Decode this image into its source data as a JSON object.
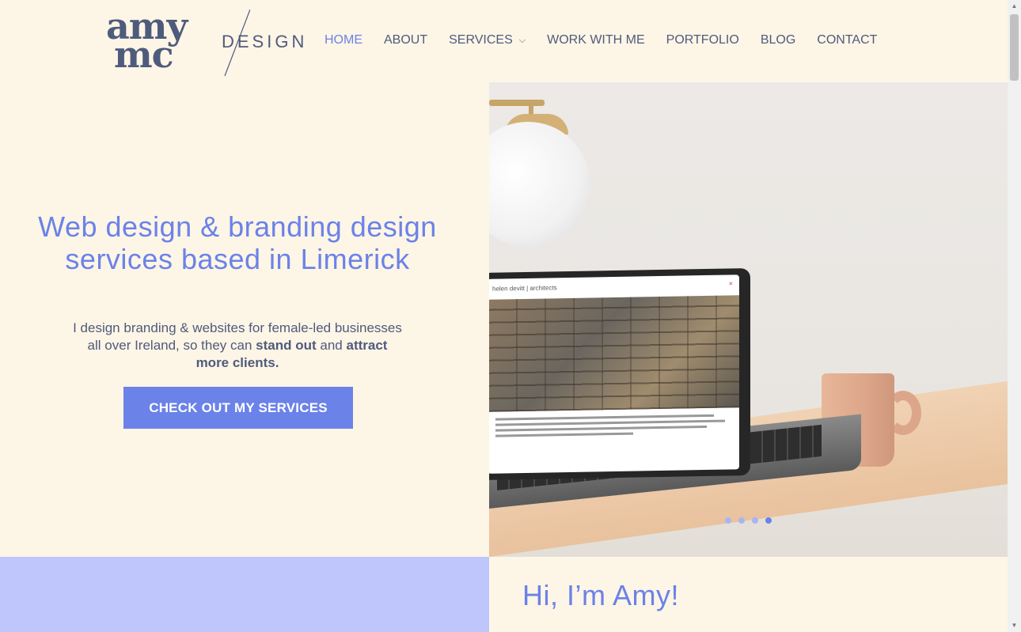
{
  "logo": {
    "line1": "amy",
    "line2": "mc",
    "wordmark": "DESIGN"
  },
  "nav": {
    "items": [
      {
        "label": "HOME",
        "active": true
      },
      {
        "label": "ABOUT"
      },
      {
        "label": "SERVICES",
        "has_dropdown": true,
        "dropdown_icon": "chevron-down-icon"
      },
      {
        "label": "WORK WITH ME"
      },
      {
        "label": "PORTFOLIO"
      },
      {
        "label": "BLOG"
      },
      {
        "label": "CONTACT"
      }
    ]
  },
  "hero": {
    "title": "Web design & branding design services based in Limerick",
    "text_before": "I design branding & websites for female-led businesses all over Ireland, so they can ",
    "text_strong1": "stand out",
    "text_middle": " and ",
    "text_strong2": "attract more clients.",
    "cta_label": "CHECK OUT MY SERVICES"
  },
  "hero_image": {
    "screen_brand": "helen devitt | architects",
    "screen_close": "×",
    "slides_total": 4,
    "active_slide": 4
  },
  "intro": {
    "heading": "Hi, I’m Amy!"
  },
  "colors": {
    "background": "#fdf5e6",
    "accent": "#6b82e8",
    "text": "#4f5b7c",
    "band": "#bec6fc"
  }
}
